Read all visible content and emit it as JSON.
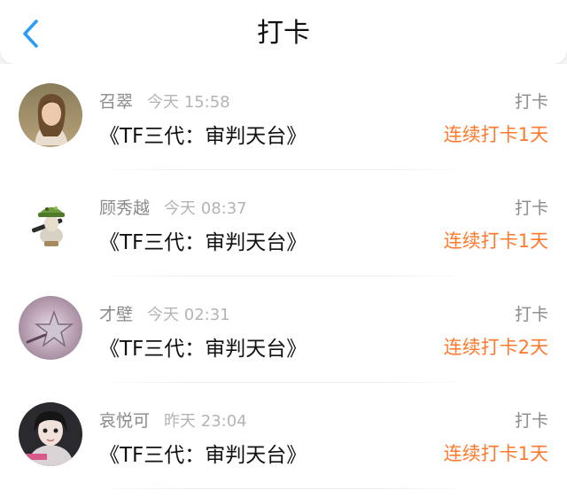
{
  "header": {
    "title": "打卡",
    "back_icon": "chevron-left-icon",
    "accent_color": "#2a9cf5"
  },
  "items": [
    {
      "name": "召翠",
      "time": "今天 15:58",
      "type": "打卡",
      "book": "《TF三代：审判天台》",
      "streak": "连续打卡1天"
    },
    {
      "name": "顾秀越",
      "time": "今天 08:37",
      "type": "打卡",
      "book": "《TF三代：审判天台》",
      "streak": "连续打卡1天"
    },
    {
      "name": "才壁",
      "time": "今天 02:31",
      "type": "打卡",
      "book": "《TF三代：审判天台》",
      "streak": "连续打卡2天"
    },
    {
      "name": "哀悦可",
      "time": "昨天 23:04",
      "type": "打卡",
      "book": "《TF三代：审判天台》",
      "streak": "连续打卡1天"
    }
  ],
  "colors": {
    "streak": "#ff7a2f",
    "name": "#8a8a8a",
    "time": "#b4b4b4"
  }
}
